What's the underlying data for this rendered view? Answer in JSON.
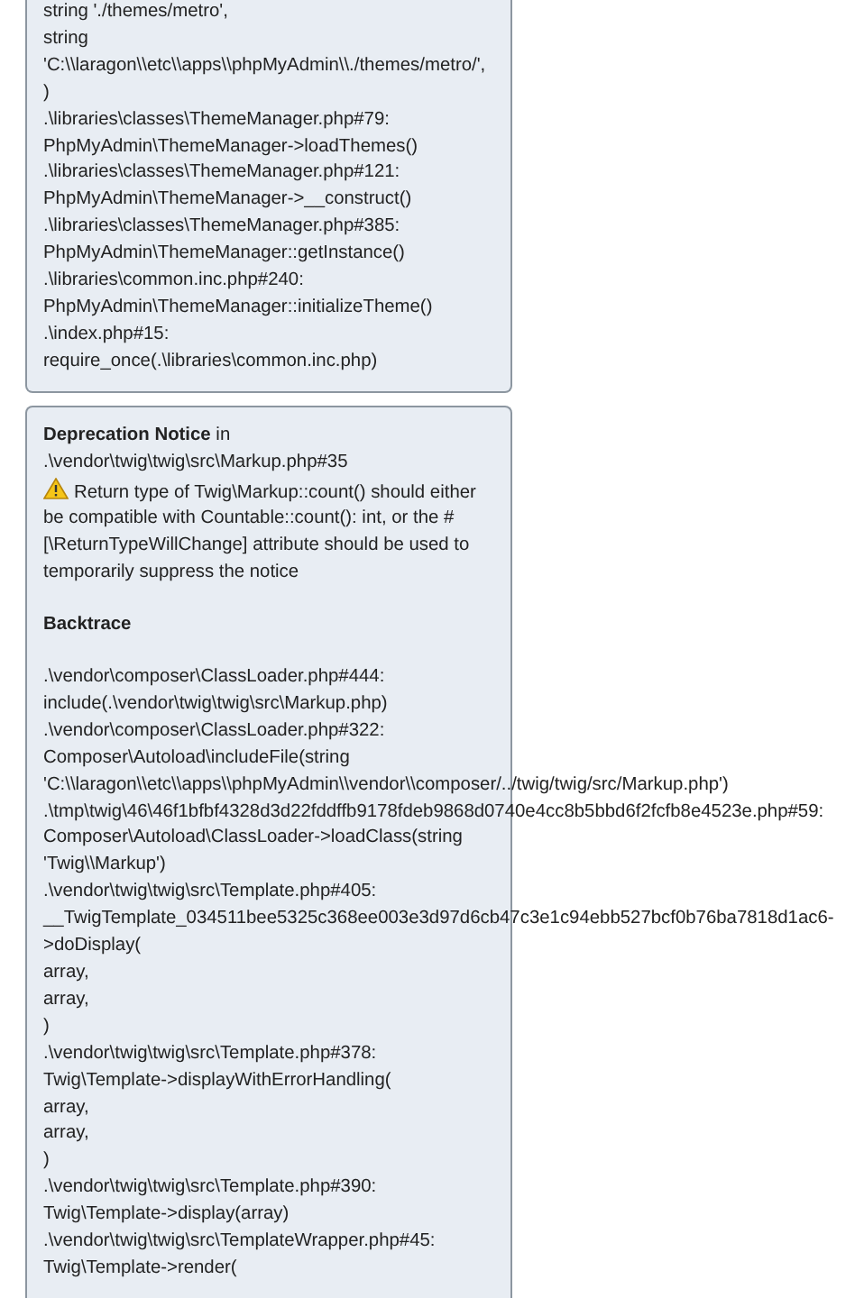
{
  "trace_block": {
    "lines": [
      "string './themes/metro',",
      "string",
      "'C:\\\\laragon\\\\etc\\\\apps\\\\phpMyAdmin\\\\./themes/metro/',",
      ")",
      ".\\libraries\\classes\\ThemeManager.php#79:",
      "PhpMyAdmin\\ThemeManager->loadThemes()",
      ".\\libraries\\classes\\ThemeManager.php#121:",
      "PhpMyAdmin\\ThemeManager->__construct()",
      ".\\libraries\\classes\\ThemeManager.php#385:",
      "PhpMyAdmin\\ThemeManager::getInstance()",
      ".\\libraries\\common.inc.php#240:",
      "PhpMyAdmin\\ThemeManager::initializeTheme()",
      ".\\index.php#15:",
      "require_once(.\\libraries\\common.inc.php)"
    ]
  },
  "notice_block": {
    "heading": "**Deprecation Notice** in",
    "file": ".\\vendor\\twig\\twig\\src\\Markup.php#35",
    "message": "Return type of Twig\\Markup::count() should either be compatible with Countable::count(): int, or the #[\\ReturnTypeWillChange] attribute should be used to temporarily suppress the notice",
    "backtrace_title": "Backtrace",
    "lines": [
      ".\\vendor\\composer\\ClassLoader.php#444:",
      "include(.\\vendor\\twig\\twig\\src\\Markup.php)",
      ".\\vendor\\composer\\ClassLoader.php#322:",
      "Composer\\Autoload\\includeFile(string",
      "'C:\\\\laragon\\\\etc\\\\apps\\\\phpMyAdmin\\\\vendor\\\\composer/../twig/twig/src/Markup.php')",
      ".\\tmp\\twig\\46\\46f1bfbf4328d3d22fddffb9178fdeb9868d0740e4cc8b5bbd6f2fcfb8e4523e.php#59:",
      "Composer\\Autoload\\ClassLoader->loadClass(string",
      "'Twig\\\\Markup')",
      ".\\vendor\\twig\\twig\\src\\Template.php#405:",
      "__TwigTemplate_034511bee5325c368ee003e3d97d6cb47c3e1c94ebb527bcf0b76ba7818d1ac6-",
      ">doDisplay(",
      "array,",
      "array,",
      ")",
      ".\\vendor\\twig\\twig\\src\\Template.php#378:",
      "Twig\\Template->displayWithErrorHandling(",
      "array,",
      "array,",
      ")",
      ".\\vendor\\twig\\twig\\src\\Template.php#390:",
      "Twig\\Template->display(array)",
      ".\\vendor\\twig\\twig\\src\\TemplateWrapper.php#45:",
      "Twig\\Template->render("
    ]
  }
}
